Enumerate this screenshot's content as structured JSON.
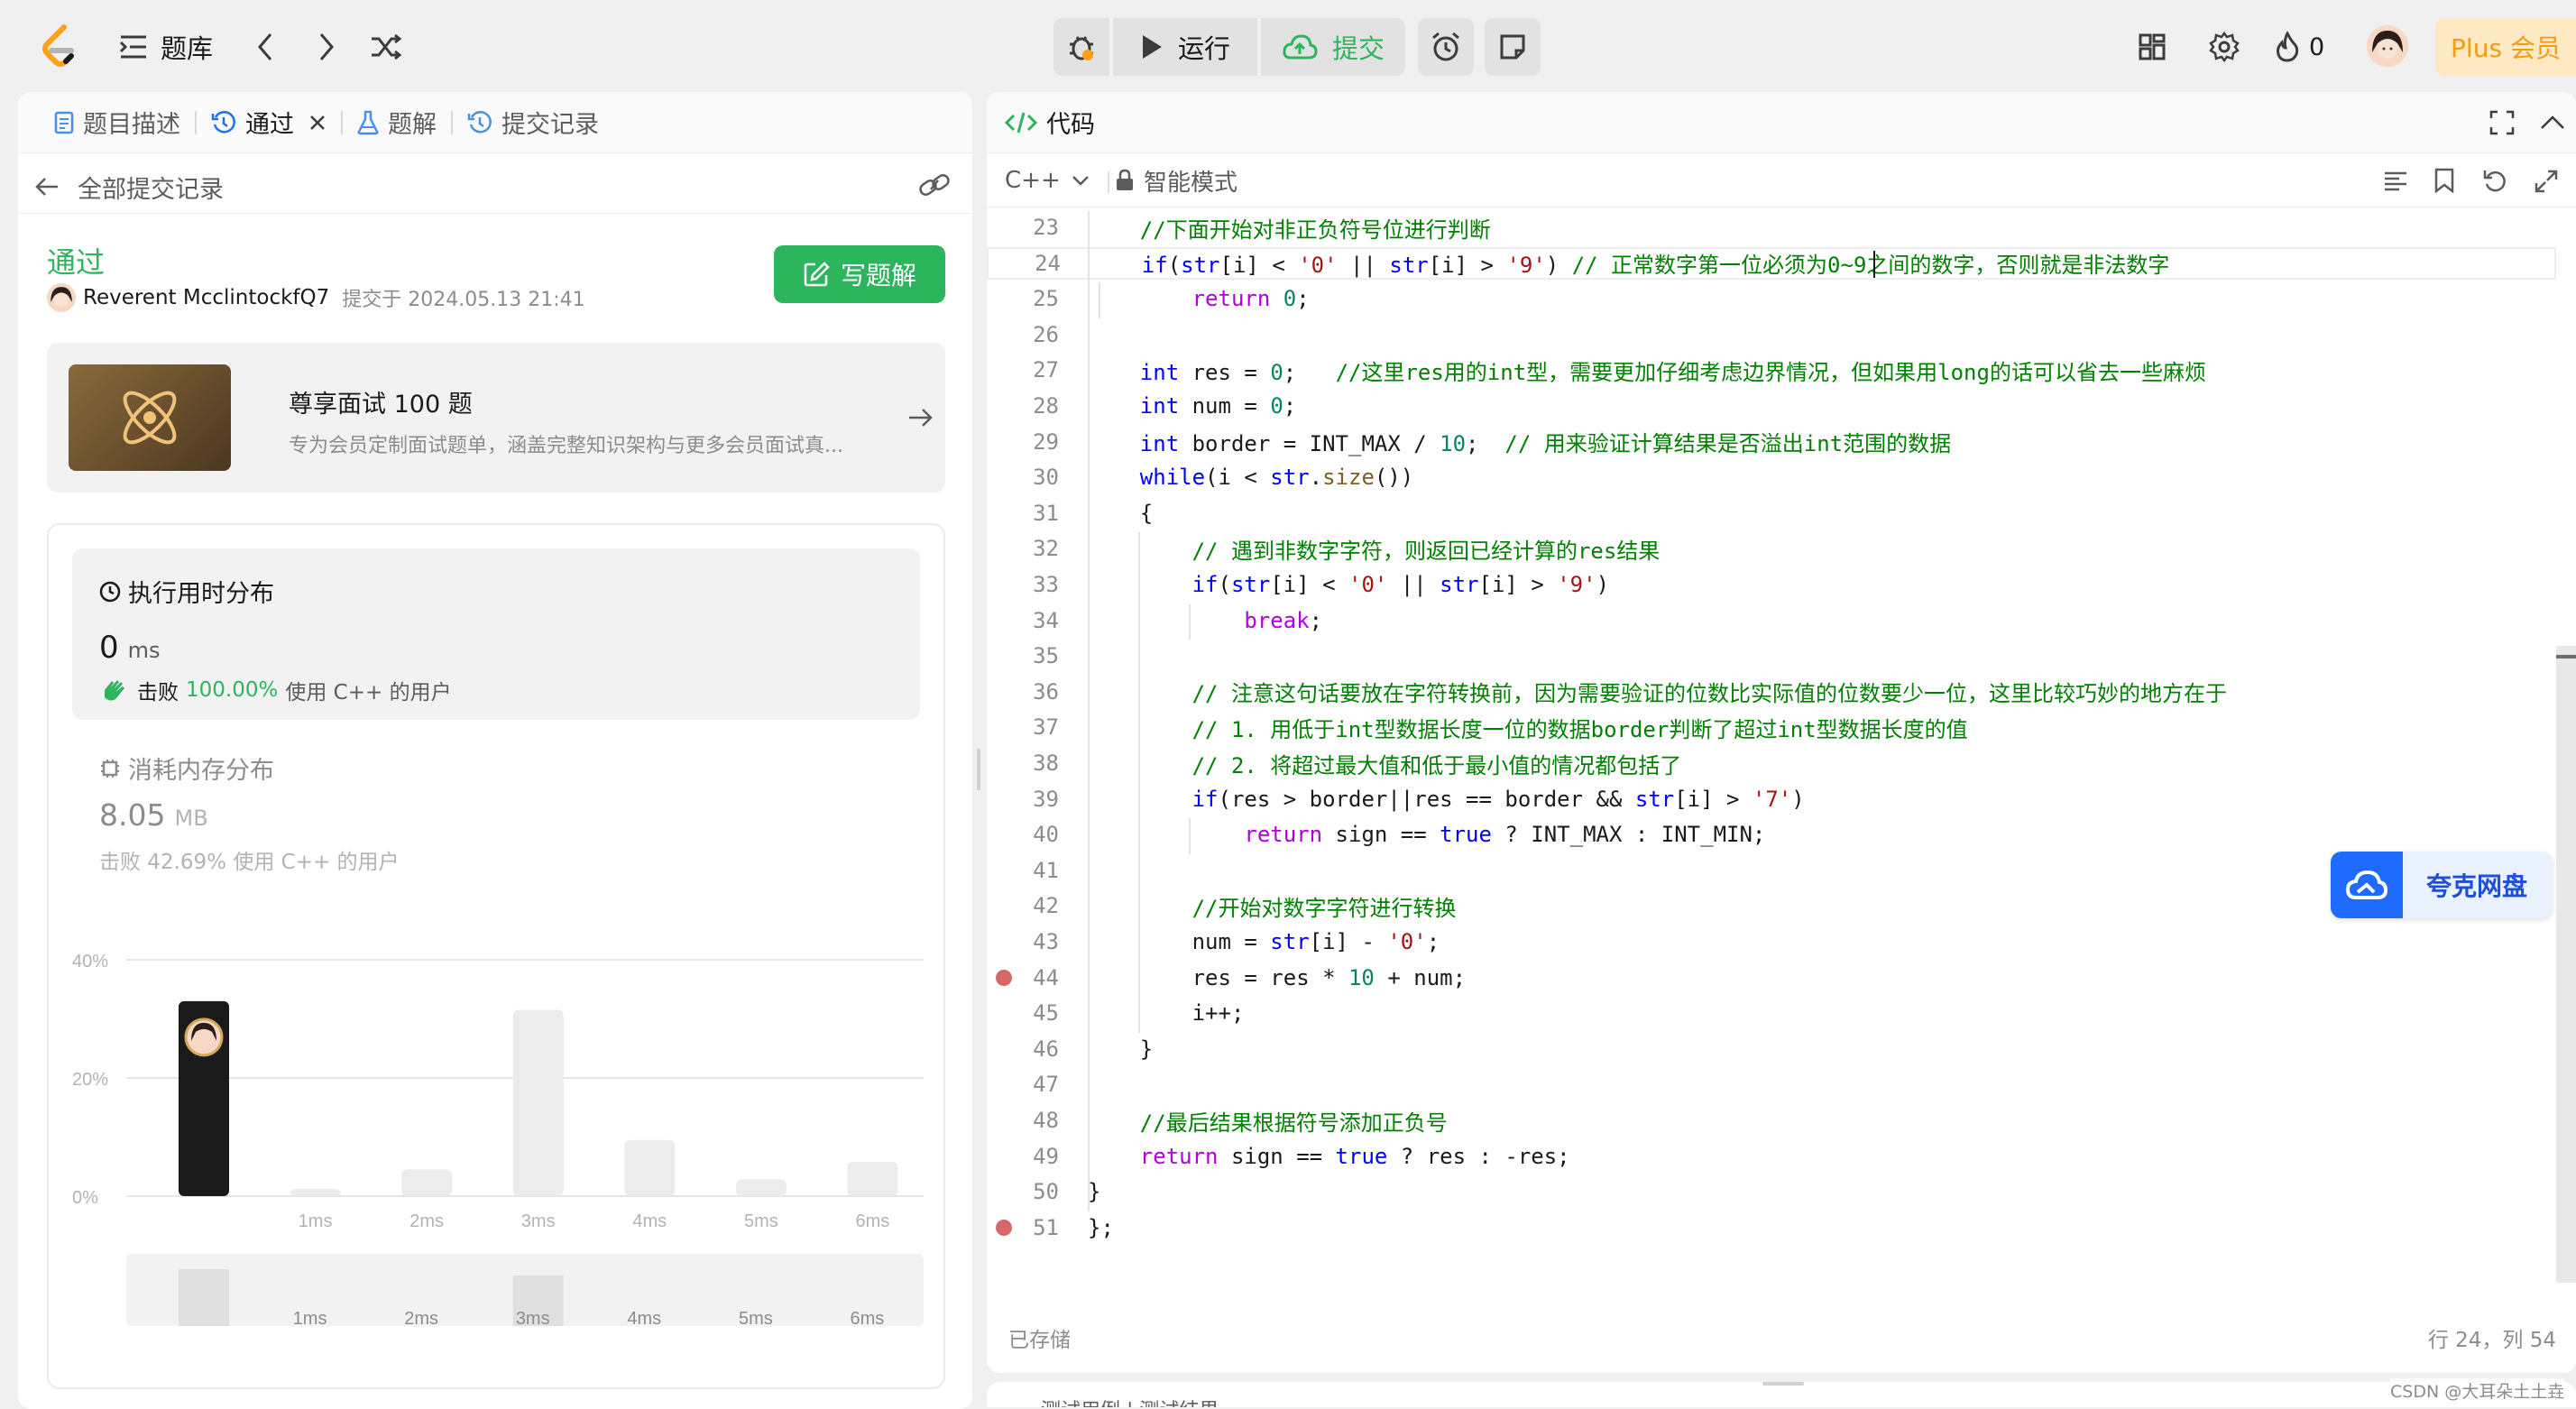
{
  "topbar": {
    "problem_bank": "题库",
    "run": "运行",
    "submit": "提交",
    "streak_count": "0",
    "plus": "Plus 会员"
  },
  "left": {
    "tabs": [
      {
        "label": "题目描述"
      },
      {
        "label": "通过"
      },
      {
        "label": "题解"
      },
      {
        "label": "提交记录"
      }
    ],
    "back_label": "全部提交记录",
    "status": "通过",
    "user": "Reverent McclintockfQ7",
    "submitted_at": "提交于 2024.05.13 21:41",
    "write_solution": "写题解",
    "promo": {
      "title": "尊享面试 100 题",
      "subtitle": "专为会员定制面试题单，涵盖完整知识架构与更多会员面试真..."
    },
    "runtime": {
      "title": "执行用时分布",
      "value": "0",
      "unit": "ms",
      "beats_prefix": "击败",
      "beats_pct": "100.00%",
      "beats_suffix": "使用 C++ 的用户"
    },
    "memory": {
      "title": "消耗内存分布",
      "value": "8.05",
      "unit": "MB",
      "beats": "击败 42.69% 使用 C++ 的用户"
    }
  },
  "chart_data": {
    "type": "bar",
    "categories": [
      "0ms",
      "1ms",
      "2ms",
      "3ms",
      "4ms",
      "5ms",
      "6ms"
    ],
    "tick_labels": [
      "",
      "1ms",
      "2ms",
      "3ms",
      "4ms",
      "5ms",
      "6ms"
    ],
    "values": [
      33,
      1.2,
      4.5,
      31.5,
      9.5,
      2.8,
      5.8
    ],
    "highlight_index": 0,
    "y_ticks": [
      "40%",
      "20%",
      "0%"
    ],
    "ylim": [
      0,
      40
    ],
    "mini_values": [
      9,
      0,
      0,
      8,
      0,
      0,
      0
    ],
    "mini_labels": [
      "",
      "1ms",
      "2ms",
      "3ms",
      "4ms",
      "5ms",
      "6ms"
    ]
  },
  "right": {
    "title": "代码",
    "language": "C++",
    "mode": "智能模式",
    "saved": "已存储",
    "cursor": "行 24，列 54",
    "quark": "夸克网盘",
    "watermark": "CSDN @大耳朵土土垚",
    "bottom_hint": "测试用例 | 测试结果"
  },
  "code_lines": [
    {
      "n": "23",
      "text": "    //下面开始对非正负符号位进行判断"
    },
    {
      "n": "24",
      "text": "    if(str[i] < '0' || str[i] > '9') // 正常数字第一位必须为0~9之间的数字，否则就是非法数字"
    },
    {
      "n": "25",
      "text": "        return 0;"
    },
    {
      "n": "26",
      "text": ""
    },
    {
      "n": "27",
      "text": "    int res = 0;   //这里res用的int型，需要更加仔细考虑边界情况，但如果用long的话可以省去一些麻烦"
    },
    {
      "n": "28",
      "text": "    int num = 0;"
    },
    {
      "n": "29",
      "text": "    int border = INT_MAX / 10;  // 用来验证计算结果是否溢出int范围的数据"
    },
    {
      "n": "30",
      "text": "    while(i < str.size())"
    },
    {
      "n": "31",
      "text": "    {"
    },
    {
      "n": "32",
      "text": "        // 遇到非数字字符，则返回已经计算的res结果"
    },
    {
      "n": "33",
      "text": "        if(str[i] < '0' || str[i] > '9')"
    },
    {
      "n": "34",
      "text": "            break;"
    },
    {
      "n": "35",
      "text": ""
    },
    {
      "n": "36",
      "text": "        // 注意这句话要放在字符转换前，因为需要验证的位数比实际值的位数要少一位，这里比较巧妙的地方在于"
    },
    {
      "n": "37",
      "text": "        // 1. 用低于int型数据长度一位的数据border判断了超过int型数据长度的值"
    },
    {
      "n": "38",
      "text": "        // 2. 将超过最大值和低于最小值的情况都包括了"
    },
    {
      "n": "39",
      "text": "        if(res > border||res == border && str[i] > '7')"
    },
    {
      "n": "40",
      "text": "            return sign == true ? INT_MAX : INT_MIN;"
    },
    {
      "n": "41",
      "text": ""
    },
    {
      "n": "42",
      "text": "        //开始对数字字符进行转换"
    },
    {
      "n": "43",
      "text": "        num = str[i] - '0';"
    },
    {
      "n": "44",
      "text": "        res = res * 10 + num;"
    },
    {
      "n": "45",
      "text": "        i++;"
    },
    {
      "n": "46",
      "text": "    }"
    },
    {
      "n": "47",
      "text": ""
    },
    {
      "n": "48",
      "text": "    //最后结果根据符号添加正负号"
    },
    {
      "n": "49",
      "text": "    return sign == true ? res : -res;"
    },
    {
      "n": "50",
      "text": "}"
    },
    {
      "n": "51",
      "text": "};"
    }
  ],
  "breakpoint_lines": [
    "44",
    "51"
  ]
}
